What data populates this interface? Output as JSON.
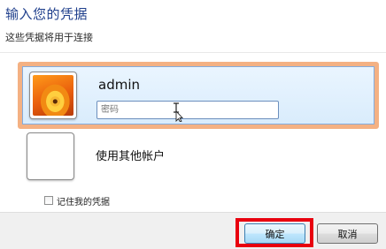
{
  "dialog": {
    "title": "输入您的凭据",
    "subtitle": "这些凭据将用于连接"
  },
  "account": {
    "username": "admin",
    "password_placeholder": "密码",
    "avatar_icon": "user-flower-avatar-icon"
  },
  "other_account": {
    "label": "使用其他帐户",
    "icon": "blank-user-tile-icon"
  },
  "remember": {
    "label": "记住我的凭据",
    "checked": false
  },
  "buttons": {
    "ok_label": "确定",
    "cancel_label": "取消"
  },
  "colors": {
    "title": "#1f3f8c",
    "selection_outline": "#f4b183",
    "ok_highlight": "#e8000f"
  }
}
